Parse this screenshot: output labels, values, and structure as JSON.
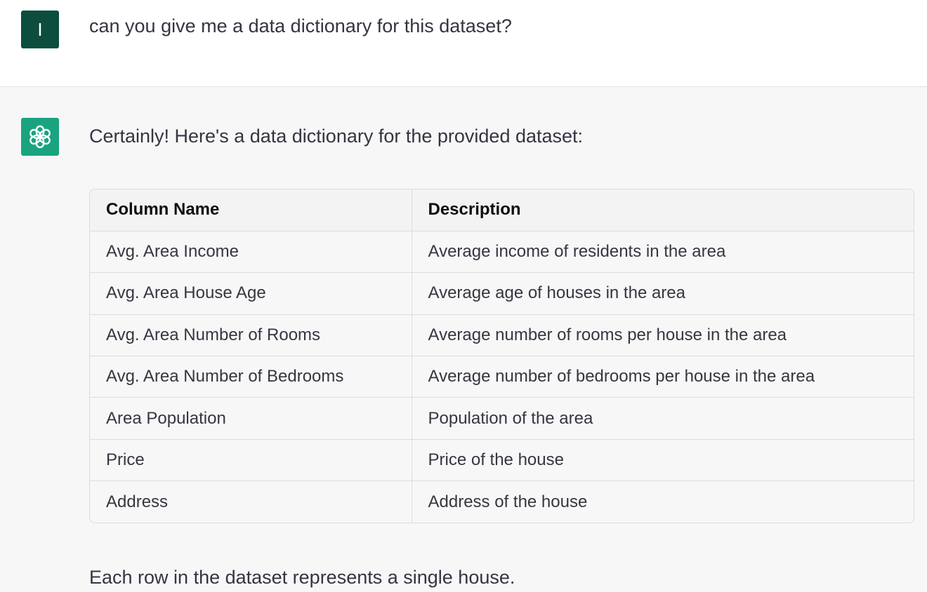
{
  "user": {
    "avatar_letter": "I",
    "message": "can you give me a data dictionary for this dataset?"
  },
  "assistant": {
    "avatar_icon": "openai-logo-icon",
    "intro": "Certainly! Here's a data dictionary for the provided dataset:",
    "table": {
      "headers": [
        "Column Name",
        "Description"
      ],
      "rows": [
        [
          "Avg. Area Income",
          "Average income of residents in the area"
        ],
        [
          "Avg. Area House Age",
          "Average age of houses in the area"
        ],
        [
          "Avg. Area Number of Rooms",
          "Average number of rooms per house in the area"
        ],
        [
          "Avg. Area Number of Bedrooms",
          "Average number of bedrooms per house in the area"
        ],
        [
          "Area Population",
          "Population of the area"
        ],
        [
          "Price",
          "Price of the house"
        ],
        [
          "Address",
          "Address of the house"
        ]
      ]
    },
    "footer": "Each row in the dataset represents a single house."
  },
  "colors": {
    "user_avatar": "#0c4d3d",
    "assistant_avatar": "#19a37f",
    "assistant_bg": "#f7f7f8"
  }
}
